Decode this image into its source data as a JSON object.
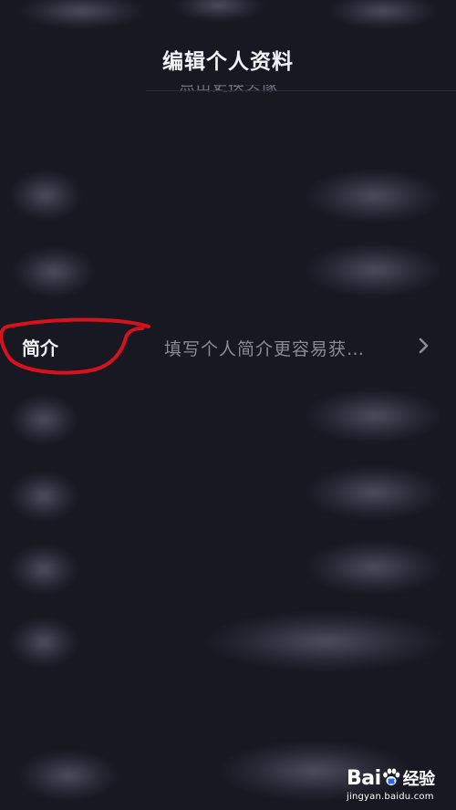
{
  "header": {
    "title": "编辑个人资料",
    "avatar_hint": "点击更换头像"
  },
  "profile": {
    "bio": {
      "label": "简介",
      "placeholder": "填写个人简介更容易获…"
    }
  },
  "colors": {
    "background": "#171822",
    "annotation": "#d8121c",
    "label": "#f0f0f3",
    "placeholder": "#8a8b99"
  },
  "watermark": {
    "brand_left": "Bai",
    "brand_right": "经验",
    "url": "jingyan.baidu.com"
  }
}
